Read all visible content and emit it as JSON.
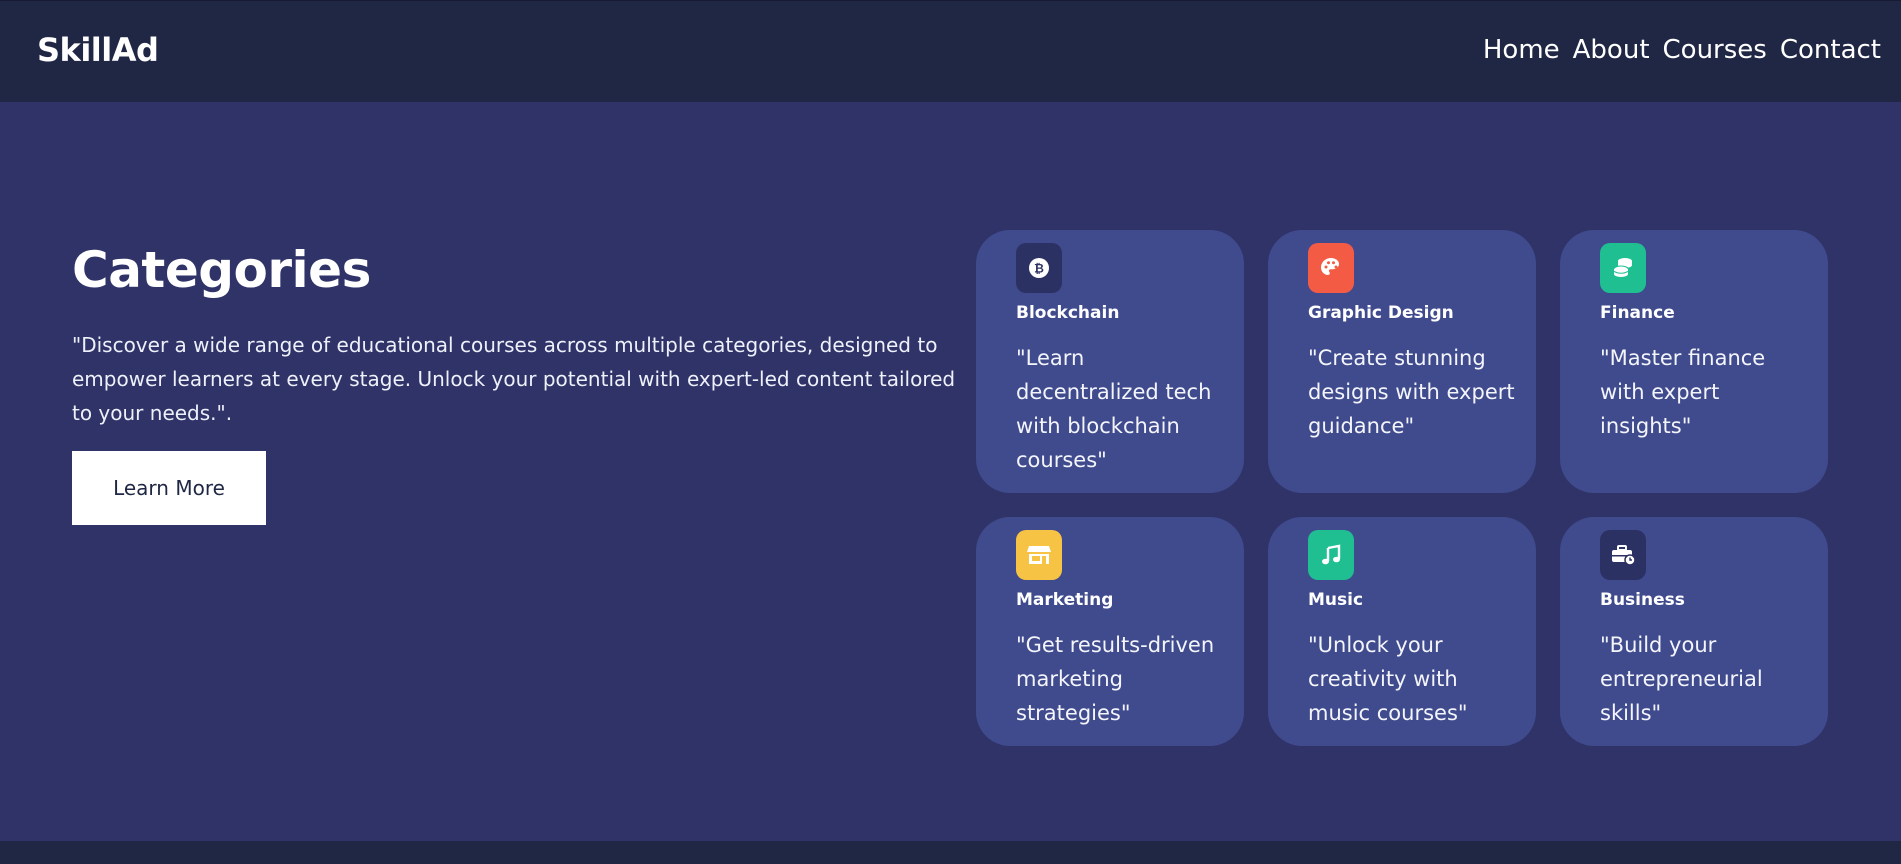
{
  "header": {
    "brand": "SkillAd",
    "nav": [
      "Home",
      "About",
      "Courses",
      "Contact"
    ]
  },
  "hero": {
    "title": "Categories",
    "description": "\"Discover a wide range of educational courses across multiple categories, designed to empower learners at every stage. Unlock your potential with expert-led content tailored to your needs.\".",
    "button_label": "Learn More"
  },
  "categories": [
    {
      "title": "Blockchain",
      "description": "\"Learn decentralized tech with blockchain courses\"",
      "icon": "bitcoin-icon",
      "color": "#2c3163"
    },
    {
      "title": "Graphic Design",
      "description": "\"Create stunning designs with expert guidance\"",
      "icon": "palette-icon",
      "color": "#f35b45"
    },
    {
      "title": "Finance",
      "description": "\"Master finance with expert insights\"",
      "icon": "coins-icon",
      "color": "#1fbf92"
    },
    {
      "title": "Marketing",
      "description": "\"Get results-driven marketing strategies\"",
      "icon": "store-icon",
      "color": "#f6c344"
    },
    {
      "title": "Music",
      "description": "\"Unlock your creativity with music courses\"",
      "icon": "music-note-icon",
      "color": "#1fbf92"
    },
    {
      "title": "Business",
      "description": "\"Build your entrepreneurial skills\"",
      "icon": "business-time-icon",
      "color": "#2c3163"
    }
  ],
  "colors": {
    "header_bg": "#1f2744",
    "page_bg": "#2f3368",
    "card_bg": "#404b8e",
    "button_bg": "#ffffff"
  }
}
